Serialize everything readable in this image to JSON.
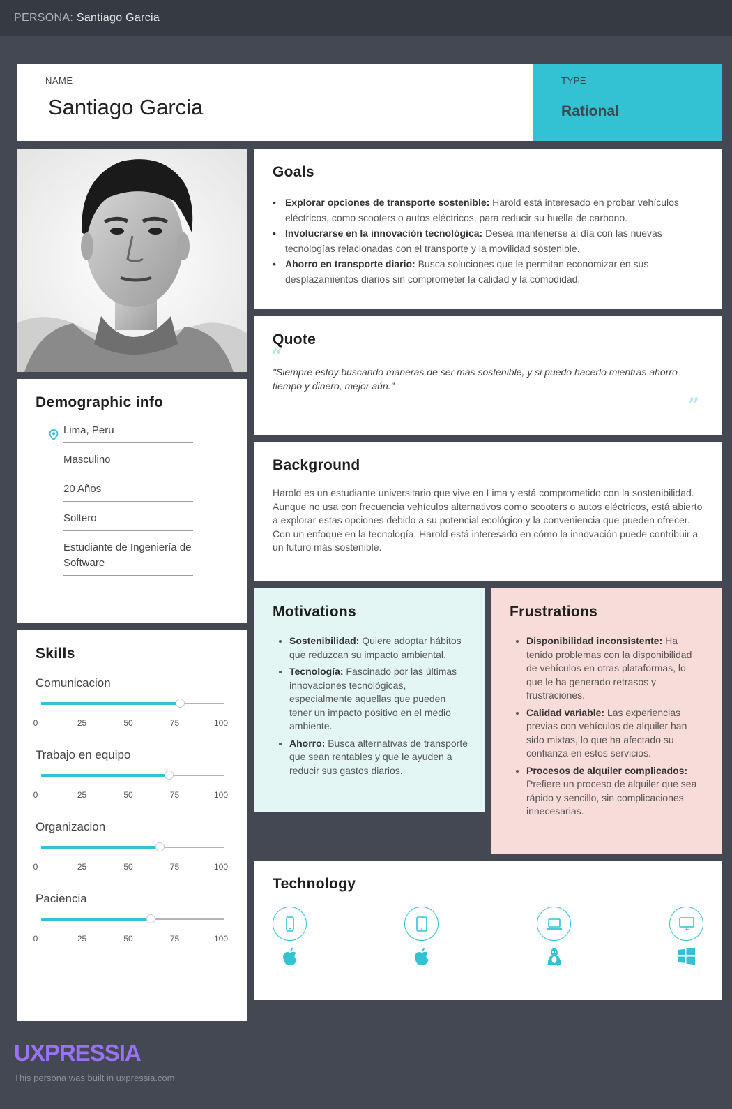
{
  "header": {
    "prefix": "PERSONA:",
    "name": "Santiago Garcia"
  },
  "name_card": {
    "label": "NAME",
    "value": "Santiago Garcia"
  },
  "type_card": {
    "label": "TYPE",
    "value": "Rational"
  },
  "demographic": {
    "title": "Demographic info",
    "items": [
      "Lima, Peru",
      "Masculino",
      "20 Años",
      "Soltero",
      "Estudiante de Ingeniería de Software"
    ]
  },
  "skills": {
    "title": "Skills",
    "ticks": [
      "0",
      "25",
      "50",
      "75",
      "100"
    ],
    "items": [
      {
        "name": "Comunicacion",
        "value": 76
      },
      {
        "name": "Trabajo en equipo",
        "value": 70
      },
      {
        "name": "Organizacion",
        "value": 65
      },
      {
        "name": "Paciencia",
        "value": 60
      }
    ]
  },
  "goals": {
    "title": "Goals",
    "items": [
      {
        "bold": "Explorar opciones de transporte sostenible:",
        "text": " Harold está interesado en probar vehículos eléctricos, como scooters o autos eléctricos, para reducir su huella de carbono."
      },
      {
        "bold": "Involucrarse en la innovación tecnológica:",
        "text": " Desea mantenerse al día con las nuevas tecnologías relacionadas con el transporte y la movilidad sostenible."
      },
      {
        "bold": "Ahorro en transporte diario:",
        "text": " Busca soluciones que le permitan economizar en sus desplazamientos diarios sin comprometer la calidad y la comodidad."
      }
    ]
  },
  "quote": {
    "title": "Quote",
    "text": "\"Siempre estoy buscando maneras de ser más sostenible, y si puedo hacerlo mientras ahorro tiempo y dinero, mejor aún.\""
  },
  "background": {
    "title": "Background",
    "text": "Harold es un estudiante universitario que vive en Lima y está comprometido con la sostenibilidad. Aunque no usa con frecuencia vehículos alternativos como scooters o autos eléctricos, está abierto a explorar estas opciones debido a su potencial ecológico y la conveniencia que pueden ofrecer. Con un enfoque en la tecnología, Harold está interesado en cómo la innovación puede contribuir a un futuro más sostenible."
  },
  "motivations": {
    "title": "Motivations",
    "items": [
      {
        "bold": "Sostenibilidad:",
        "text": " Quiere adoptar hábitos que reduzcan su impacto ambiental."
      },
      {
        "bold": "Tecnología:",
        "text": " Fascinado por las últimas innovaciones tecnológicas, especialmente aquellas que pueden tener un impacto positivo en el medio ambiente."
      },
      {
        "bold": "Ahorro:",
        "text": " Busca alternativas de transporte que sean rentables y que le ayuden a reducir sus gastos diarios."
      }
    ]
  },
  "frustrations": {
    "title": "Frustrations",
    "items": [
      {
        "bold": "Disponibilidad inconsistente:",
        "text": " Ha tenido problemas con la disponibilidad de vehículos en otras plataformas, lo que le ha generado retrasos y frustraciones."
      },
      {
        "bold": "Calidad variable:",
        "text": " Las experiencias previas con vehículos de alquiler han sido mixtas, lo que ha afectado su confianza en estos servicios."
      },
      {
        "bold": "Procesos de alquiler complicados:",
        "text": " Prefiere un proceso de alquiler que sea rápido y sencillo, sin complicaciones innecesarias."
      }
    ]
  },
  "technology": {
    "title": "Technology",
    "devices": [
      {
        "device": "smartphone-icon",
        "os": "apple-icon"
      },
      {
        "device": "tablet-icon",
        "os": "apple-icon"
      },
      {
        "device": "laptop-icon",
        "os": "linux-icon"
      },
      {
        "device": "desktop-icon",
        "os": "windows-icon"
      }
    ],
    "accent": "#33c2d4"
  },
  "brand": {
    "logo": "UXPRESSIA",
    "footer": "This persona was built in uxpressia.com"
  }
}
